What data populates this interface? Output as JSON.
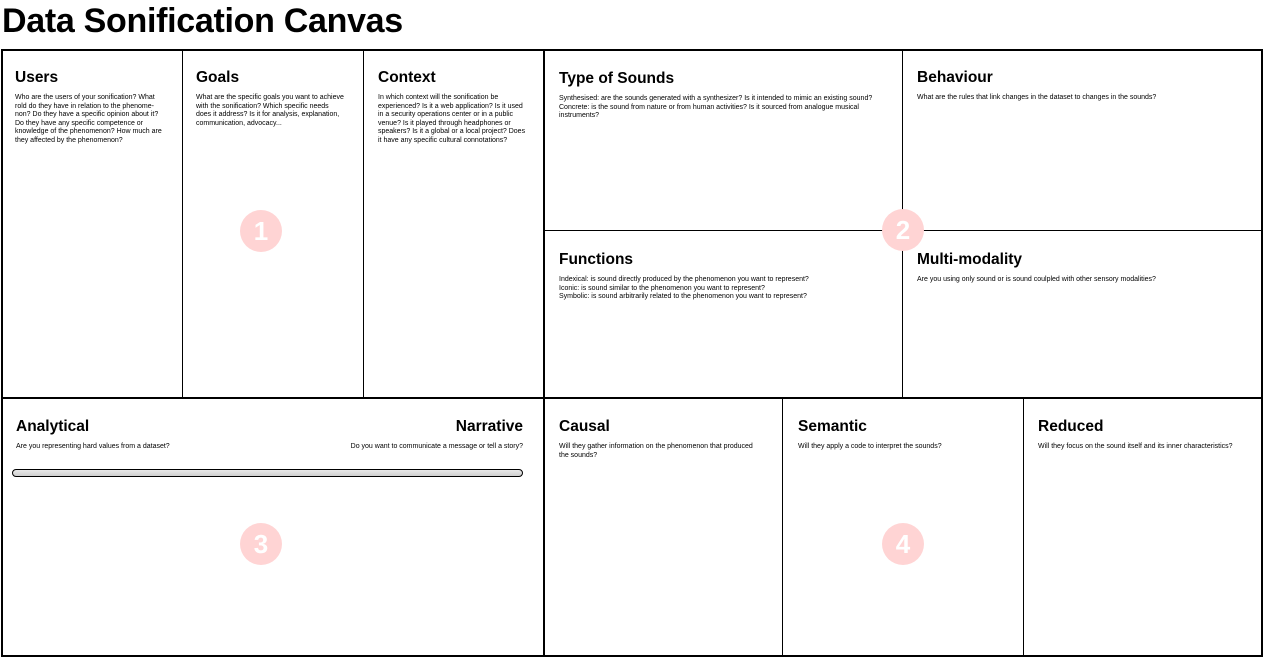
{
  "page_title": "Data Sonification Canvas",
  "sections": {
    "users": {
      "title": "Users",
      "desc": "Who are the users of your sonification? What\nrold do they have in relation to the phenome-\nnon? Do they have a specific opinion about it?\nDo they have any specific competence or\nknowledge of the phenomenon? How much are\nthey affected by the phenomenon?"
    },
    "goals": {
      "title": "Goals",
      "desc": "What are the specific goals you want to achieve\nwith the sonification? Which specific needs\ndoes it address? Is it for analysis, explanation,\ncommunication, advocacy..."
    },
    "context": {
      "title": "Context",
      "desc": "In which context will the sonification be\nexperienced? Is it a web application? Is it used\nin a security operations center or in a public\nvenue? Is it played through headphones or\nspeakers? Is it a global or a local project? Does\nit have any specific cultural connotations?"
    },
    "type_of_sounds": {
      "title": "Type of Sounds",
      "desc": "Synthesised: are the sounds generated with a synthesizer? Is it intended to mimic an existing sound?\nConcrete: is the sound from nature or from human activities? Is it sourced from analogue musical\ninstruments?"
    },
    "behaviour": {
      "title": "Behaviour",
      "desc": "What are the rules that link changes in the dataset to changes in the sounds?"
    },
    "functions": {
      "title": "Functions",
      "desc": "Indexical: is sound directly produced by the phenomenon you want to represent?\nIconic: is sound similar to the phenomenon you want to represent?\nSymbolic: is sound arbitrarily related to the phenomenon you want to represent?"
    },
    "multi_modality": {
      "title": "Multi-modality",
      "desc": "Are you using only sound or is sound coulpled with other sensory modalities?"
    },
    "analytical": {
      "title": "Analytical",
      "desc": "Are you representing hard values from a dataset?"
    },
    "narrative": {
      "title": "Narrative",
      "desc": "Do you want to communicate a message or tell a story?"
    },
    "causal": {
      "title": "Causal",
      "desc": "Will they gather information on the phenomenon that produced\nthe sounds?"
    },
    "semantic": {
      "title": "Semantic",
      "desc": "Will they apply a code to interpret the sounds?"
    },
    "reduced": {
      "title": "Reduced",
      "desc": "Will they focus on the sound itself and its inner characteristics?"
    }
  },
  "badges": [
    "1",
    "2",
    "3",
    "4"
  ],
  "colors": {
    "badge_fill": "#ffd4d4",
    "line": "#000000"
  }
}
